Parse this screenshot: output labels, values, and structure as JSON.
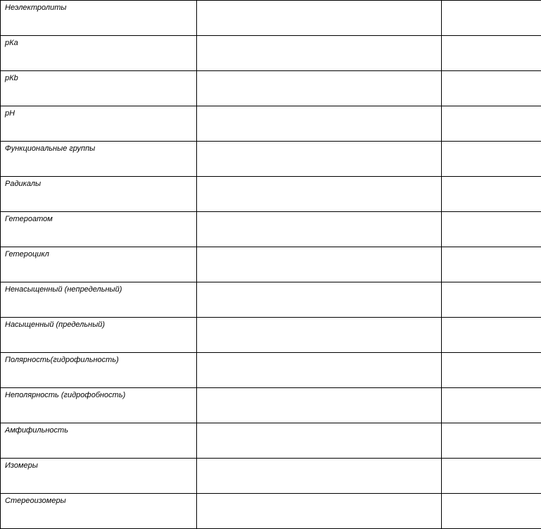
{
  "rows": [
    {
      "term": "Неэлектролиты",
      "col2": "",
      "col3": ""
    },
    {
      "term": "рКа",
      "col2": "",
      "col3": ""
    },
    {
      "term": "рКb",
      "col2": "",
      "col3": ""
    },
    {
      "term": "рН",
      "col2": "",
      "col3": ""
    },
    {
      "term": "Функциональные группы",
      "col2": "",
      "col3": ""
    },
    {
      "term": "Радикалы",
      "col2": "",
      "col3": ""
    },
    {
      "term": "Гетероатом",
      "col2": "",
      "col3": ""
    },
    {
      "term": "Гетероцикл",
      "col2": "",
      "col3": ""
    },
    {
      "term": "Ненасыщенный (непредельный)",
      "col2": "",
      "col3": ""
    },
    {
      "term": "Насыщенный (предельный)",
      "col2": "",
      "col3": ""
    },
    {
      "term": "Полярность(гидрофильность)",
      "col2": "",
      "col3": ""
    },
    {
      "term": "Неполярность (гидрофобность)",
      "col2": "",
      "col3": ""
    },
    {
      "term": "Амфифильность",
      "col2": "",
      "col3": ""
    },
    {
      "term": "Изомеры",
      "col2": "",
      "col3": ""
    },
    {
      "term": "Стереоизомеры",
      "col2": "",
      "col3": ""
    }
  ]
}
